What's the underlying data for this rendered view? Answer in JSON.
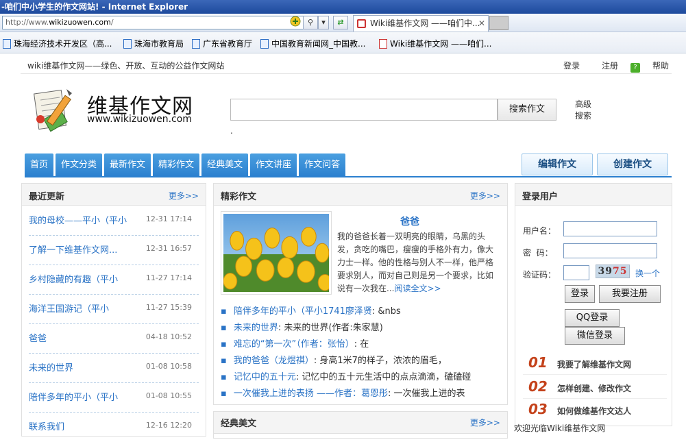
{
  "browser": {
    "title": "-咱们中小学生的作文网站! - Internet Explorer",
    "address_prefix": "http://www.",
    "address_domain": "wikizuowen.com",
    "address_suffix": "/",
    "tab_label": "Wiki维基作文网 ——咱们中...",
    "favorites": [
      "珠海经济技术开发区（高...",
      "珠海市教育局",
      "广东省教育厅",
      "中国教育新闻网_中国教...",
      "Wiki维基作文网 ——咱们..."
    ]
  },
  "site": {
    "tagline": "wiki维基作文网——绿色、开放、互动的公益作文网站",
    "top_links": {
      "login": "登录",
      "register": "注册",
      "help": "帮助"
    },
    "logo_title": "维基作文网",
    "logo_url": "www.wikizuowen.com",
    "search_placeholder": "",
    "search_button": "搜索作文",
    "advanced_search": "高级搜索",
    "dot": "."
  },
  "nav": {
    "items": [
      "首页",
      "作文分类",
      "最新作文",
      "精彩作文",
      "经典美文",
      "作文讲座",
      "作文问答"
    ],
    "edit_button": "编辑作文",
    "create_button": "创建作文"
  },
  "recent": {
    "title": "最近更新",
    "more": "更多>>",
    "items": [
      {
        "title": "我的母校——平小（平小",
        "time": "12-31 17:14"
      },
      {
        "title": "了解一下维基作文网...",
        "time": "12-31 16:57"
      },
      {
        "title": "乡村隐藏的有趣（平小",
        "time": "11-27 17:14"
      },
      {
        "title": "海洋王国游记（平小",
        "time": "11-27 15:39"
      },
      {
        "title": "爸爸",
        "time": "04-18 10:52"
      },
      {
        "title": "未来的世界",
        "time": "01-08 10:58"
      },
      {
        "title": "陪伴多年的平小（平小",
        "time": "01-08 10:55"
      },
      {
        "title": "联系我们",
        "time": "12-16 12:20"
      }
    ]
  },
  "featured": {
    "title": "精彩作文",
    "more": "更多>>",
    "article_title": "爸爸",
    "excerpt": "我的爸爸长着一双明亮的眼睛，乌黑的头发，贪吃的嘴巴，瘦瘦的手格外有力，像大力士一样。他的性格与别人不一样，他严格要求别人，而对自己则是另一个要求，比如说有一次我在...",
    "read_all": "阅读全文>>",
    "list": [
      {
        "link": "陪伴多年的平小（平小1741廖泽贤",
        "snippet": ":                    &nbs"
      },
      {
        "link": "未来的世界",
        "snippet": ":              未来的世界(作者:朱家慧)"
      },
      {
        "link": "难忘的“第一次”（作者：张怡）",
        "snippet": ":                    在"
      },
      {
        "link": "我的爸爸（龙煜祺）",
        "snippet": ":           身高1米7的样子，浓浓的眉毛，"
      },
      {
        "link": "记忆中的五十元",
        "snippet": ": 记忆中的五十元生活中的点点滴滴，磕磕碰"
      },
      {
        "link": "一次催我上进的表扬 ——作者：葛恩彤",
        "snippet": ":      一次催我上进的表"
      }
    ]
  },
  "classic": {
    "title": "经典美文",
    "more": "更多>>"
  },
  "login": {
    "title": "登录用户",
    "username_label": "用户名：",
    "password_label": "密  码：",
    "captcha_label": "验证码：",
    "captcha_a": "39",
    "captcha_b": "75",
    "swap": "换一个",
    "login_button": "登录",
    "register_button": "我要注册",
    "qq_button": "QQ登录",
    "wechat_button": "微信登录",
    "steps": [
      {
        "num": "01",
        "text": "我要了解维基作文网"
      },
      {
        "num": "02",
        "text": "怎样创建、修改作文"
      },
      {
        "num": "03",
        "text": "如何做维基作文达人"
      }
    ],
    "welcome": "欢迎光临Wiki维基作文网"
  }
}
